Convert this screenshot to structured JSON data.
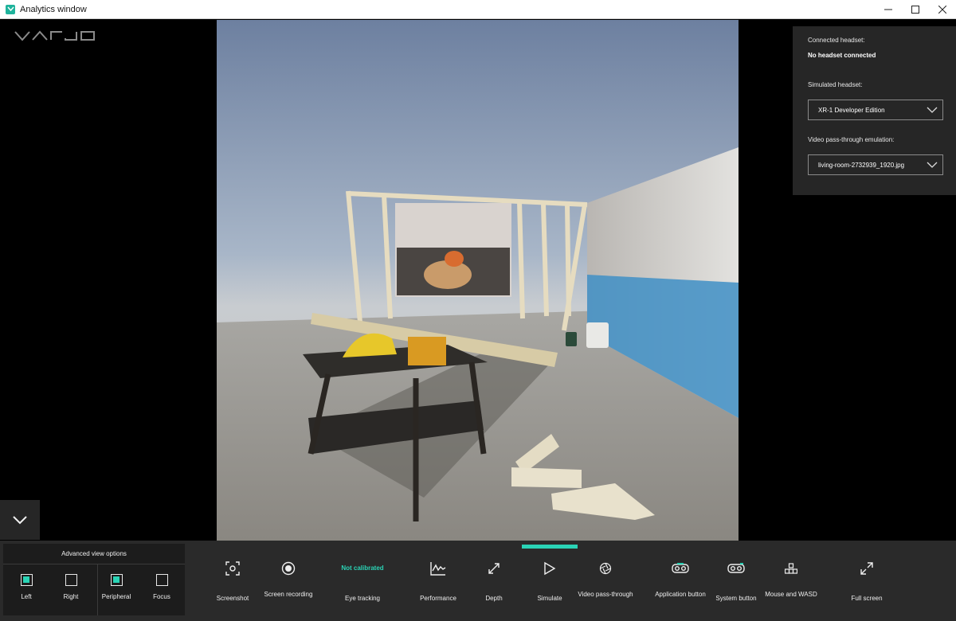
{
  "window": {
    "title": "Analytics window"
  },
  "right_panel": {
    "connected_label": "Connected headset:",
    "connected_value": "No headset connected",
    "simulated_label": "Simulated headset:",
    "simulated_value": "XR-1 Developer Edition",
    "passthrough_label": "Video pass-through emulation:",
    "passthrough_value": "living-room-2732939_1920.jpg"
  },
  "advanced": {
    "title": "Advanced view options",
    "items": [
      {
        "label": "Left",
        "checked": true
      },
      {
        "label": "Right",
        "checked": false
      },
      {
        "label": "Peripheral",
        "checked": true
      },
      {
        "label": "Focus",
        "checked": false
      }
    ]
  },
  "toolbar": {
    "screenshot": "Screenshot",
    "screen_recording": "Screen recording",
    "eye_tracking_status": "Not calibrated",
    "eye_tracking": "Eye tracking",
    "performance": "Performance",
    "depth": "Depth",
    "simulate": "Simulate",
    "video_passthrough": "Video pass-through",
    "application_button": "Application button",
    "system_button": "System button",
    "mouse_wasd": "Mouse and WASD",
    "full_screen": "Full screen"
  },
  "colors": {
    "accent": "#2ad3b5",
    "panel": "#262626",
    "bar": "#2a2a2a"
  }
}
